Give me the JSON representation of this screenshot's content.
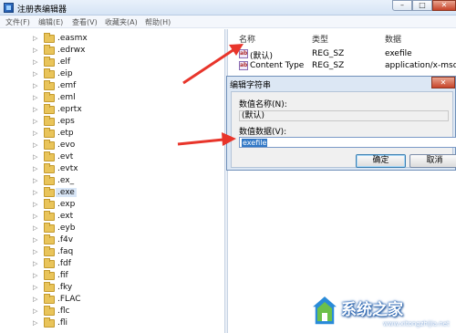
{
  "window": {
    "title": "注册表编辑器"
  },
  "menu": [
    "文件(F)",
    "编辑(E)",
    "查看(V)",
    "收藏夹(A)",
    "帮助(H)"
  ],
  "tree": [
    ".easmx",
    ".edrwx",
    ".elf",
    ".eip",
    ".emf",
    ".eml",
    ".eprtx",
    ".eps",
    ".etp",
    ".evo",
    ".evt",
    ".evtx",
    ".ex_",
    ".exe",
    ".exp",
    ".ext",
    ".eyb",
    ".f4v",
    ".faq",
    ".fdf",
    ".fif",
    ".fky",
    ".FLAC",
    ".flc",
    ".fli"
  ],
  "tree_selected": ".exe",
  "list": {
    "columns": [
      "名称",
      "类型",
      "数据"
    ],
    "rows": [
      {
        "name": "(默认)",
        "type": "REG_SZ",
        "data": "exefile"
      },
      {
        "name": "Content Type",
        "type": "REG_SZ",
        "data": "application/x-msdow"
      }
    ]
  },
  "dialog": {
    "title": "编辑字符串",
    "value_name_label": "数值名称(N):",
    "value_name": "(默认)",
    "value_data_label": "数值数据(V):",
    "value_data": "exefile",
    "ok_label": "确定",
    "cancel_label": "取消"
  },
  "watermark": {
    "text": "系统之家",
    "url": "www.xitongzhijia.net"
  },
  "colors": {
    "arrow": "#e8352b",
    "folder": "#e9c45a",
    "selection": "#3178c6"
  }
}
